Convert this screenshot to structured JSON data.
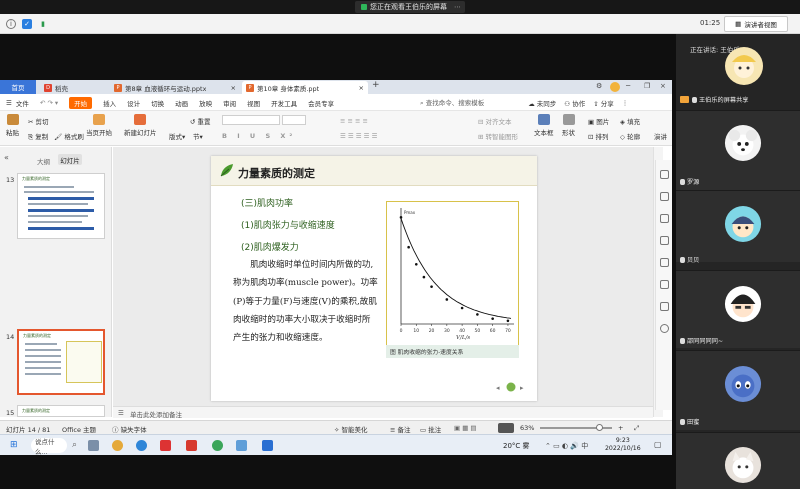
{
  "meeting": {
    "share_banner": "您正在观看王伯乐的屏幕",
    "time": "01:25",
    "view_button": "演讲者视图",
    "speaking_label": "正在讲话: 王伯乐;",
    "participants": [
      {
        "name": "王伯乐的屏幕共享"
      },
      {
        "name": "罗源"
      },
      {
        "name": "贝贝"
      },
      {
        "name": "邵同同同同~"
      },
      {
        "name": "田蜜"
      }
    ]
  },
  "tabs": {
    "home": "首页",
    "daoke": "稻壳",
    "ppt8": "第8章 血液循环与运动.pptx",
    "ppt10": "第10章 身体素质.ppt",
    "plus": "+"
  },
  "menu": {
    "file": "文件",
    "start": "开始",
    "insert": "插入",
    "design": "设计",
    "transition": "切换",
    "animation": "动画",
    "show": "放映",
    "review": "审阅",
    "view": "视图",
    "dev": "开发工具",
    "vip": "会员专享",
    "search": "查找命令、搜索模板",
    "sync": "未同步",
    "collab": "协作",
    "share": "分享"
  },
  "toolbar": {
    "paste": "粘贴",
    "cut": "剪切",
    "copy": "复制",
    "format_painter": "格式刷",
    "from_current": "当页开始",
    "new_slide": "新建幻灯片",
    "layout": "版式",
    "section": "节",
    "reset": "重置",
    "align_text": "对齐文本",
    "convert_smartart": "转智能图形",
    "textbox": "文本框",
    "shapes": "形状",
    "arrange": "排列",
    "picture": "图片",
    "fill": "填充",
    "outline": "轮廓",
    "present": "演讲"
  },
  "left_panel": {
    "outline_tab": "大纲",
    "slides_tab": "幻灯片",
    "thumbs": [
      {
        "num": "13",
        "title": "力量素质的测定"
      },
      {
        "num": "14",
        "title": "力量素质的测定"
      },
      {
        "num": "15",
        "title": "力量素质的测定"
      }
    ]
  },
  "slide": {
    "title": "力量素质的测定",
    "heading": "(三)肌肉功率",
    "point1": "(1)肌肉张力与收缩速度",
    "point2": "(2)肌肉爆发力",
    "body": "肌肉收缩时单位时间内所做的功,称为肌肉功率(muscle power)。功率(P)等于力量(F)与速度(V)的乘积,故肌肉收缩时的功率大小取决于收缩时所产生的张力和收缩速度。",
    "figure_caption": "图  肌肉收缩的张力-速度关系",
    "fig_xlabel": "V/L/s",
    "fig_ymax": "Pmax"
  },
  "notes_placeholder": "单击此处添加备注",
  "status": {
    "slide_counter": "幻灯片 14 / 81",
    "theme": "Office 主题",
    "missing_font": "缺失字体",
    "smart_beautify": "智能美化",
    "notes": "备注",
    "comment": "批注",
    "zoom": "63%"
  },
  "taskbar": {
    "search": "说点什么...",
    "weather": "20°C 雾",
    "time": "9:23",
    "date": "2022/10/16"
  },
  "colors": {
    "wps_orange": "#ff6a00",
    "home_tab_blue": "#3a75d8",
    "slide_green": "#2d5f1e",
    "figure_border": "#d8c24a"
  },
  "chart_data": {
    "type": "scatter",
    "title": "",
    "xlabel": "V/L/s",
    "ylabel": "",
    "x": [
      0,
      5,
      10,
      15,
      20,
      30,
      40,
      50,
      60,
      70
    ],
    "xticks": [
      "0",
      "10",
      "20",
      "30",
      "40",
      "50",
      "60",
      "70"
    ],
    "y": [
      1.0,
      0.72,
      0.56,
      0.44,
      0.35,
      0.23,
      0.15,
      0.09,
      0.05,
      0.03
    ],
    "ylim": [
      0,
      1.05
    ],
    "xlim": [
      0,
      72
    ],
    "grid": false
  }
}
